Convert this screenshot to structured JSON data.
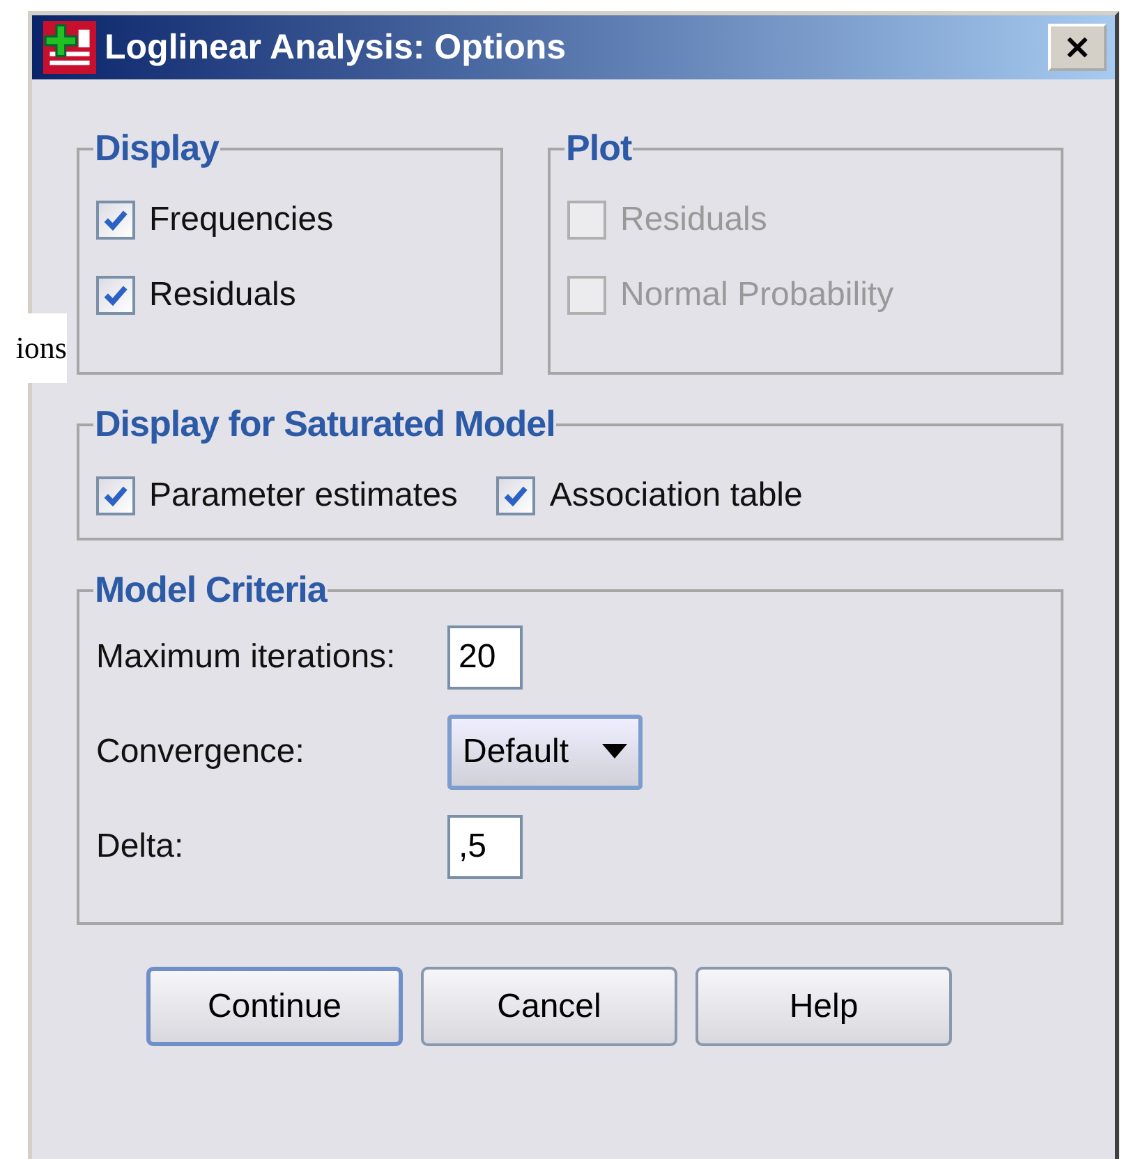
{
  "window": {
    "title": "Loglinear Analysis: Options"
  },
  "overlay_text": "ions",
  "groups": [
    {
      "kind": "checks",
      "title": "Display",
      "checkboxes": [
        {
          "label": "Frequencies",
          "checked": true,
          "disabled": false
        },
        {
          "label": "Residuals",
          "checked": true,
          "disabled": false
        }
      ]
    },
    {
      "kind": "checks",
      "title": "Plot",
      "checkboxes": [
        {
          "label": "Residuals",
          "checked": false,
          "disabled": true
        },
        {
          "label": "Normal Probability",
          "checked": false,
          "disabled": true
        }
      ]
    },
    {
      "kind": "checks",
      "title": "Display for Saturated Model",
      "checkboxes": [
        {
          "label": "Parameter estimates",
          "checked": true,
          "disabled": false
        },
        {
          "label": "Association table",
          "checked": true,
          "disabled": false
        }
      ]
    },
    {
      "kind": "fields",
      "title": "Model Criteria",
      "fields": [
        {
          "kind": "text",
          "label": "Maximum iterations:",
          "value": "20"
        },
        {
          "kind": "dropdown",
          "label": "Convergence:",
          "value": "Default"
        },
        {
          "kind": "text",
          "label": "Delta:",
          "value": ",5"
        }
      ]
    }
  ],
  "buttons": [
    {
      "label": "Continue",
      "default": true
    },
    {
      "label": "Cancel",
      "default": false
    },
    {
      "label": "Help",
      "default": false
    }
  ]
}
